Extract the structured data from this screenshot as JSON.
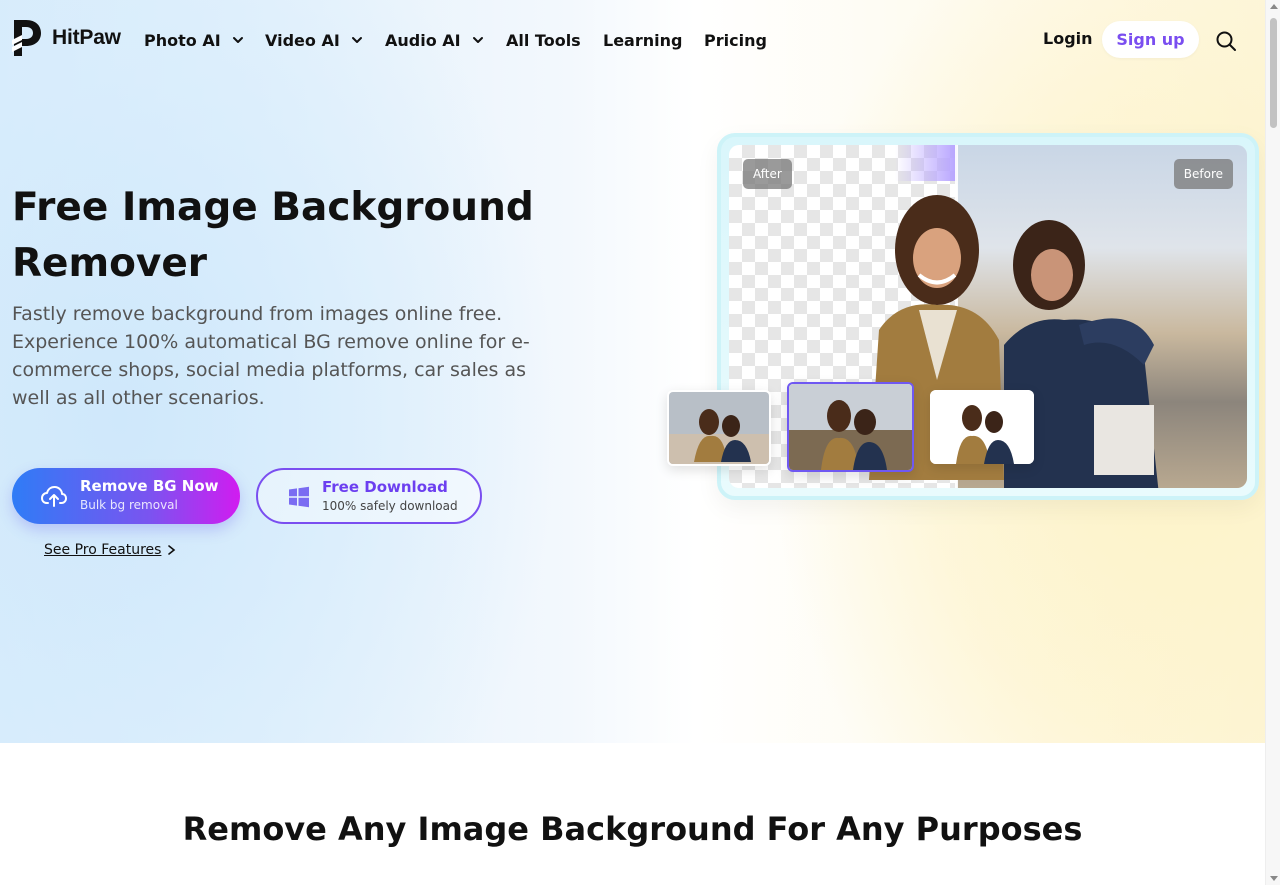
{
  "brand": {
    "name": "HitPaw"
  },
  "nav": {
    "items": [
      {
        "label": "Photo AI",
        "has_dropdown": true
      },
      {
        "label": "Video AI",
        "has_dropdown": true
      },
      {
        "label": "Audio AI",
        "has_dropdown": true
      },
      {
        "label": "All Tools",
        "has_dropdown": false
      },
      {
        "label": "Learning",
        "has_dropdown": false
      },
      {
        "label": "Pricing",
        "has_dropdown": false
      }
    ],
    "login_label": "Login",
    "signup_label": "Sign up",
    "search_icon": "search-icon"
  },
  "hero": {
    "title": "Free Image Background Remover",
    "subtitle": "Fastly remove background from images online free. Experience 100% automatical BG remove online for e-commerce shops, social media platforms, car sales as well as all other scenarios.",
    "primary_button": {
      "label": "Remove BG Now",
      "sublabel": "Bulk bg removal",
      "icon": "upload-cloud-icon"
    },
    "secondary_button": {
      "label": "Free Download",
      "sublabel": "100% safely download",
      "icon": "windows-icon"
    },
    "pro_link": "See Pro Features",
    "image_tags": {
      "after": "After",
      "before": "Before"
    }
  },
  "section": {
    "title": "Remove Any Image Background For Any Purposes"
  },
  "colors": {
    "accent": "#7a4ef0",
    "primary_gradient_start": "#2f7cf6",
    "primary_gradient_end": "#d11cf0",
    "text": "#111111",
    "subtext": "#555555"
  }
}
